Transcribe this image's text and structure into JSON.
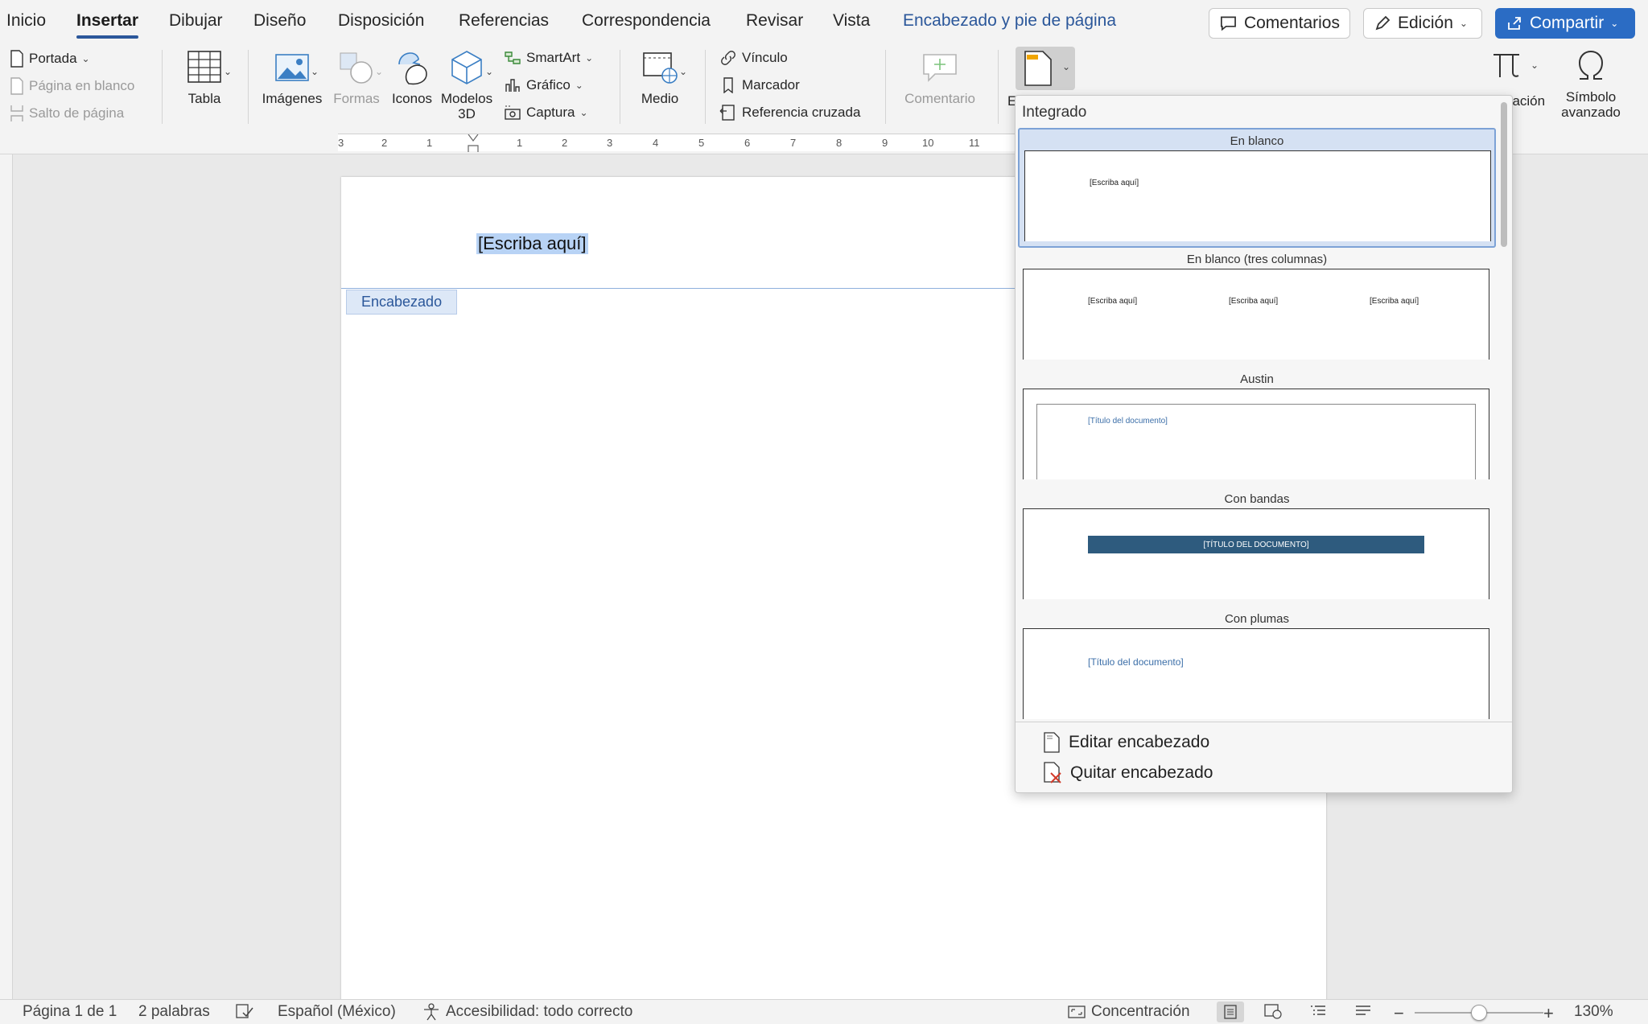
{
  "tabs": {
    "inicio": "Inicio",
    "insertar": "Insertar",
    "dibujar": "Dibujar",
    "diseno": "Diseño",
    "disposicion": "Disposición",
    "referencias": "Referencias",
    "correspondencia": "Correspondencia",
    "revisar": "Revisar",
    "vista": "Vista",
    "encabezado_pie": "Encabezado y pie de página"
  },
  "top_buttons": {
    "comentarios": "Comentarios",
    "edicion": "Edición",
    "compartir": "Compartir"
  },
  "ribbon": {
    "portada": "Portada",
    "pagina_en_blanco": "Página en blanco",
    "salto_de_pagina": "Salto de página",
    "tabla": "Tabla",
    "imagenes": "Imágenes",
    "formas": "Formas",
    "iconos": "Iconos",
    "modelos_3d_line1": "Modelos",
    "modelos_3d_line2": "3D",
    "smartart": "SmartArt",
    "grafico": "Gráfico",
    "captura": "Captura",
    "medio": "Medio",
    "vinculo": "Vínculo",
    "marcador": "Marcador",
    "referencia_cruzada": "Referencia cruzada",
    "comentario": "Comentario",
    "encabezado_partial": "E",
    "ecuacion_partial": "uación",
    "simbolo_line1": "Símbolo",
    "simbolo_line2": "avanzado"
  },
  "ruler": {
    "numbers": [
      "3",
      "2",
      "1",
      "1",
      "2",
      "3",
      "4",
      "5",
      "6",
      "7",
      "8",
      "9",
      "10",
      "11"
    ]
  },
  "page": {
    "header_text": "[Escriba aquí]",
    "header_tag": "Encabezado"
  },
  "dropdown": {
    "section": "Integrado",
    "items": [
      {
        "title": "En blanco",
        "preview": [
          "[Escriba aquí]"
        ]
      },
      {
        "title": "En blanco (tres columnas)",
        "preview": [
          "[Escriba aquí]",
          "[Escriba aquí]",
          "[Escriba aquí]"
        ]
      },
      {
        "title": "Austin",
        "preview": [
          "[Título del documento]"
        ]
      },
      {
        "title": "Con bandas",
        "preview": [
          "[TÍTULO DEL DOCUMENTO]"
        ]
      },
      {
        "title": "Con plumas",
        "preview": [
          "[Título del documento]"
        ]
      }
    ],
    "edit": "Editar encabezado",
    "remove": "Quitar encabezado"
  },
  "status": {
    "pagina": "Página 1 de 1",
    "palabras": "2 palabras",
    "idioma": "Español (México)",
    "accesibilidad": "Accesibilidad: todo correcto",
    "concentracion": "Concentración",
    "zoom": "130%"
  },
  "colors": {
    "accent": "#2b579a",
    "share": "#2b6cc4",
    "banded": "#2e5b7e",
    "selection": "#b8d3f5"
  }
}
